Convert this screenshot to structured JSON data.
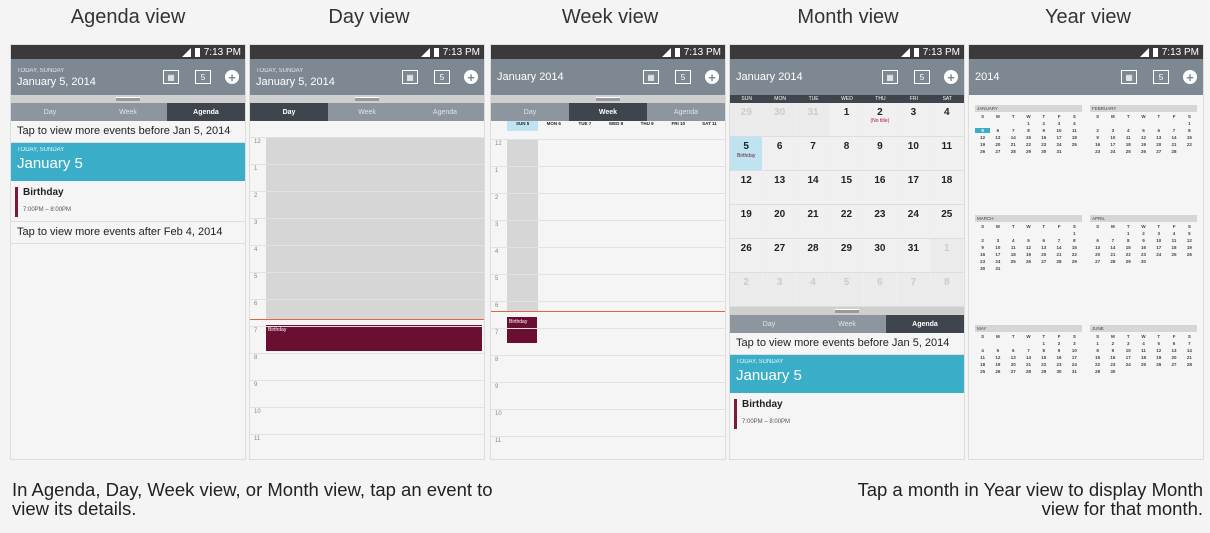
{
  "titles": {
    "agenda": "Agenda view",
    "day": "Day view",
    "week": "Week view",
    "month": "Month view",
    "year": "Year view"
  },
  "status": {
    "time": "7:13 PM"
  },
  "agenda": {
    "date_small": "TODAY, SUNDAY",
    "date": "January 5, 2014",
    "tabs": [
      "Day",
      "Week",
      "Agenda"
    ],
    "more_before": "Tap to view more events before Jan 5, 2014",
    "today_label": "TODAY, SUNDAY",
    "today_date": "January 5",
    "event_title": "Birthday",
    "event_time": "7:00PM – 8:00PM",
    "more_after": "Tap to view more events after Feb 4, 2014"
  },
  "day": {
    "date_small": "TODAY, SUNDAY",
    "date": "January 5, 2014",
    "tabs": [
      "Day",
      "Week",
      "Agenda"
    ],
    "hours": [
      "12",
      "1",
      "2",
      "3",
      "4",
      "5",
      "6",
      "7",
      "8",
      "9",
      "10",
      "11"
    ],
    "event": "Birthday"
  },
  "week": {
    "date": "January 2014",
    "tabs": [
      "Day",
      "Week",
      "Agenda"
    ],
    "days": [
      "SUN 5",
      "MON 6",
      "TUE 7",
      "WED 8",
      "THU 9",
      "FRI 10",
      "SAT 11"
    ],
    "hours": [
      "12",
      "1",
      "2",
      "3",
      "4",
      "5",
      "6",
      "7",
      "8",
      "9",
      "10",
      "11"
    ],
    "event": "Birthday"
  },
  "month": {
    "date": "January 2014",
    "dow": [
      "SUN",
      "MON",
      "TUE",
      "WED",
      "THU",
      "FRI",
      "SAT"
    ],
    "rows": [
      [
        "29",
        "30",
        "31",
        "1",
        "2",
        "3",
        "4"
      ],
      [
        "5",
        "6",
        "7",
        "8",
        "9",
        "10",
        "11"
      ],
      [
        "12",
        "13",
        "14",
        "15",
        "16",
        "17",
        "18"
      ],
      [
        "19",
        "20",
        "21",
        "22",
        "23",
        "24",
        "25"
      ],
      [
        "26",
        "27",
        "28",
        "29",
        "30",
        "31",
        "1"
      ],
      [
        "2",
        "3",
        "4",
        "5",
        "6",
        "7",
        "8"
      ]
    ],
    "event_label": "Birthday",
    "untitled": "(No title)",
    "tabs": [
      "Day",
      "Week",
      "Agenda"
    ],
    "more_before": "Tap to view more events before Jan 5, 2014",
    "today_label": "TODAY, SUNDAY",
    "today_date": "January 5",
    "event_title": "Birthday",
    "event_time": "7:00PM – 8:00PM"
  },
  "year": {
    "date": "2014",
    "months": [
      "JANUARY",
      "FEBRUARY",
      "MARCH",
      "APRIL",
      "MAY",
      "JUNE"
    ],
    "dow": [
      "S",
      "M",
      "T",
      "W",
      "T",
      "F",
      "S"
    ]
  },
  "captions": {
    "left": "In Agenda, Day, Week view, or Month view, tap an event to view its details.",
    "right": "Tap a month in Year view to display Month view for that month."
  },
  "colors": {
    "accent": "#3aaec9",
    "event": "#6b0f32",
    "appbar": "#7e8892"
  }
}
